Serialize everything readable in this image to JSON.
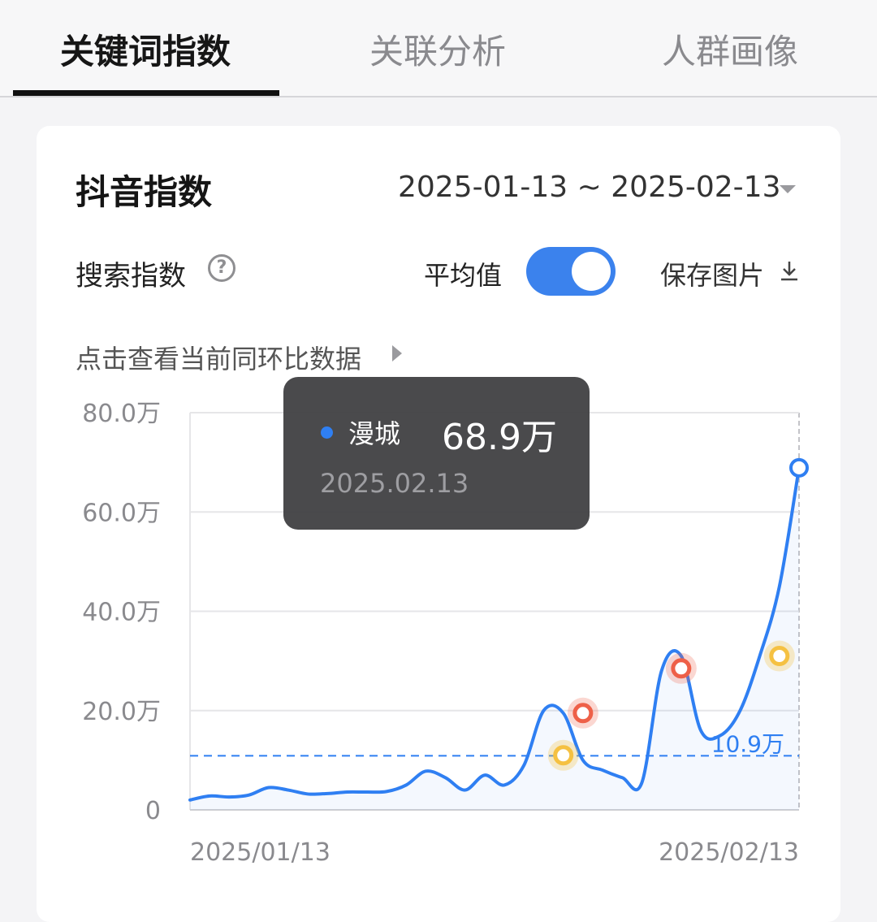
{
  "tabs": [
    {
      "label": "关键词指数",
      "active": true
    },
    {
      "label": "关联分析",
      "active": false
    },
    {
      "label": "人群画像",
      "active": false
    }
  ],
  "card": {
    "title": "抖音指数",
    "date_range": "2025-01-13 ~ 2025-02-13",
    "metric_label": "搜索指数",
    "help_icon": "question-circle-icon",
    "average_label": "平均值",
    "average_toggle_on": true,
    "save_label": "保存图片",
    "save_icon": "download-icon",
    "compare_link": "点击查看当前同环比数据"
  },
  "chart_data": {
    "type": "line",
    "yticks": [
      "80.0万",
      "60.0万",
      "40.0万",
      "20.0万",
      "0"
    ],
    "ylim": [
      0,
      80
    ],
    "xticks": [
      "2025/01/13",
      "2025/02/13"
    ],
    "grid": true,
    "average": {
      "value": 10.9,
      "label": "10.9万"
    },
    "series": [
      {
        "color": "#2f7ff2",
        "x": [
          "2025/01/13",
          "2025/01/14",
          "2025/01/15",
          "2025/01/16",
          "2025/01/17",
          "2025/01/18",
          "2025/01/19",
          "2025/01/20",
          "2025/01/21",
          "2025/01/22",
          "2025/01/23",
          "2025/01/24",
          "2025/01/25",
          "2025/01/26",
          "2025/01/27",
          "2025/01/28",
          "2025/01/29",
          "2025/01/30",
          "2025/01/31",
          "2025/02/01",
          "2025/02/02",
          "2025/02/03",
          "2025/02/04",
          "2025/02/05",
          "2025/02/06",
          "2025/02/07",
          "2025/02/08",
          "2025/02/09",
          "2025/02/10",
          "2025/02/11",
          "2025/02/12",
          "2025/02/13"
        ],
        "values": [
          2.0,
          2.8,
          2.6,
          3.0,
          4.5,
          4.0,
          3.2,
          3.3,
          3.6,
          3.6,
          3.7,
          5.0,
          7.8,
          6.5,
          4.0,
          7.0,
          5.0,
          9.0,
          20.0,
          19.5,
          10.0,
          8.0,
          6.5,
          5.5,
          28.0,
          31.0,
          16.0,
          15.0,
          20.0,
          31.0,
          45.0,
          68.9
        ],
        "markers": [
          {
            "x": "2025/02/01",
            "value": 11.0,
            "kind": "yellow"
          },
          {
            "x": "2025/02/02",
            "value": 19.5,
            "kind": "red"
          },
          {
            "x": "2025/02/07",
            "value": 28.5,
            "kind": "red"
          },
          {
            "x": "2025/02/12",
            "value": 31.0,
            "kind": "yellow"
          }
        ]
      }
    ],
    "highlight": {
      "x": "2025/02/13",
      "value": 68.9
    }
  },
  "tooltip": {
    "series": "漫城",
    "value": "68.9万",
    "date": "2025.02.13"
  }
}
